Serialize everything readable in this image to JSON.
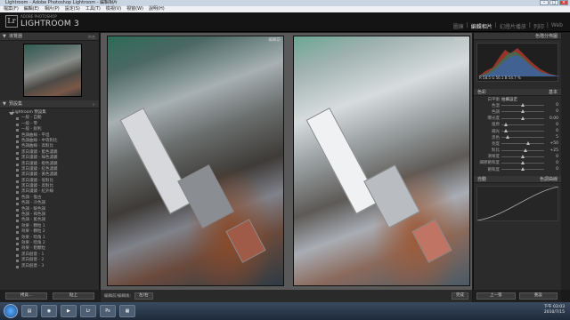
{
  "window": {
    "title": "Lightroom - Adobe Photoshop Lightroom - 編輯相片",
    "controls": [
      "–",
      "□",
      "×"
    ]
  },
  "menu": [
    "檔案(F)",
    "編輯(E)",
    "相片(P)",
    "設定(S)",
    "工具(T)",
    "檢視(V)",
    "視窗(W)",
    "說明(H)"
  ],
  "header": {
    "adobe": "ADOBE PHOTOSHOP",
    "app_name": "LIGHTROOM 3",
    "logo": "Lr",
    "modules": [
      "圖庫",
      "編輯相片",
      "幻燈片播放",
      "列印",
      "Web"
    ],
    "active_module": "編輯相片"
  },
  "left_panel": {
    "navigator_label": "導覽器",
    "navigator_zoom": "符合",
    "presets_label": "預設集",
    "presets_folder": "Lightroom 預設集",
    "presets": [
      "一般 - 自動",
      "一般 - 零",
      "一般 - 銳利",
      "色調曲線 - 平坦",
      "色調曲線 - 中等對比",
      "色調曲線 - 高對比",
      "黑白濾鏡 - 藍色濾鏡",
      "黑白濾鏡 - 綠色濾鏡",
      "黑白濾鏡 - 橙色濾鏡",
      "黑白濾鏡 - 紅色濾鏡",
      "黑白濾鏡 - 黃色濾鏡",
      "黑白濾鏡 - 低對比",
      "黑白濾鏡 - 高對比",
      "黑白濾鏡 - 紅外線",
      "色調 - 復古",
      "色調 - 冷色調",
      "色調 - 暖色調",
      "色調 - 褐色調",
      "色調 - 藍色調",
      "效果 - 顆粒 1",
      "效果 - 顆粒 2",
      "效果 - 暗角 1",
      "效果 - 暗角 2",
      "效果 - 粗顆粒",
      "黑白創意 - 1",
      "黑白創意 - 2",
      "黑白創意 - 3"
    ],
    "copy_button": "拷貝...",
    "paste_button": "貼上"
  },
  "center": {
    "before_label": "編輯前",
    "after_label": "編輯後",
    "view_mode": "編輯前/編輯後:",
    "view_option": "左/右",
    "done_button": "完成"
  },
  "right_panel": {
    "histogram_label": "色階分佈圖",
    "histogram_readout": "R 58.5  G 56.1  B 54.7 %",
    "basic_label": "基本",
    "treatment": [
      "色彩",
      "黑白"
    ],
    "wb_label": "白平衡",
    "wb_value": "拍攝設定",
    "tone_label": "色調",
    "tone_auto": "自動",
    "sliders": [
      {
        "name": "色溫",
        "value": "0",
        "pos": 0.5
      },
      {
        "name": "色調",
        "value": "0",
        "pos": 0.5
      },
      {
        "name": "曝光度",
        "value": "0.00",
        "pos": 0.5
      },
      {
        "name": "復原",
        "value": "0",
        "pos": 0.1
      },
      {
        "name": "補光",
        "value": "0",
        "pos": 0.1
      },
      {
        "name": "黑色",
        "value": "5",
        "pos": 0.15
      },
      {
        "name": "亮度",
        "value": "+50",
        "pos": 0.62
      },
      {
        "name": "對比",
        "value": "+25",
        "pos": 0.56
      },
      {
        "name": "清晰度",
        "value": "0",
        "pos": 0.5
      },
      {
        "name": "細節飽和度",
        "value": "0",
        "pos": 0.5
      },
      {
        "name": "飽和度",
        "value": "0",
        "pos": 0.5
      }
    ],
    "presence_label": "外觀",
    "tonecurve_label": "色調曲線",
    "prev_button": "上一張",
    "reset_button": "重設"
  },
  "taskbar": {
    "time": "下午 03:03",
    "date": "2010/7/15"
  }
}
